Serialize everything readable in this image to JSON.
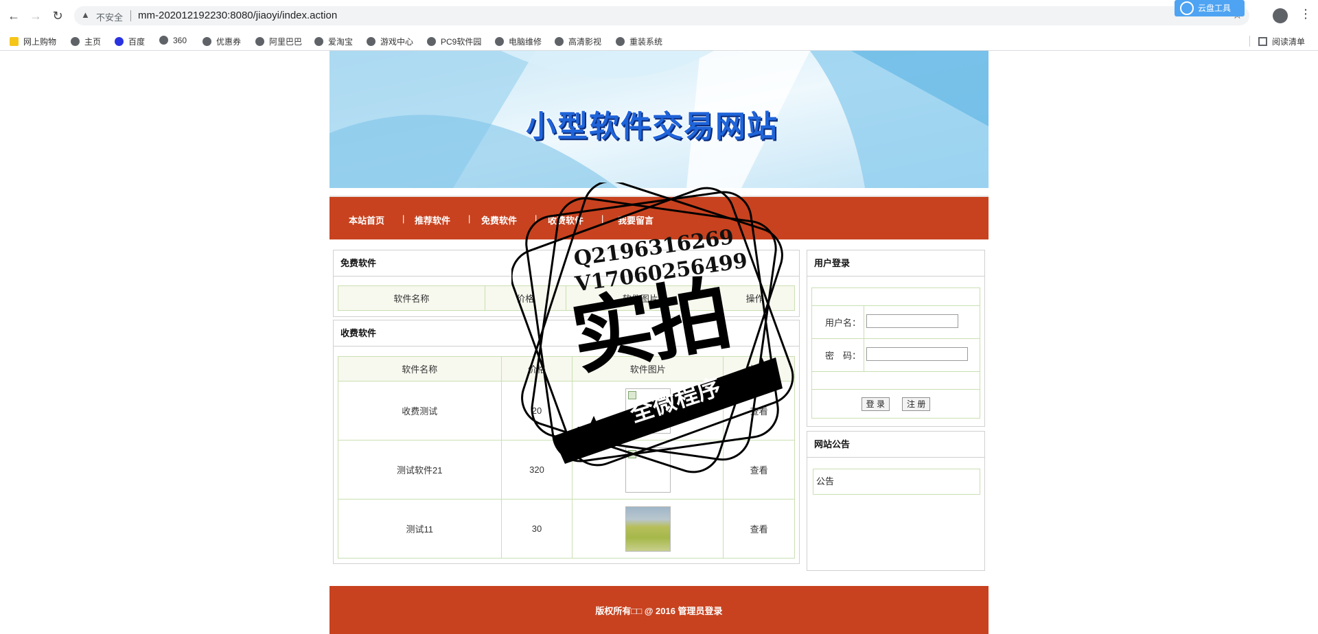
{
  "browser": {
    "insecure_label": "不安全",
    "url": "mm-202012192230:8080/jiaoyi/index.action",
    "extension_label": "云盘工具",
    "bookmarks": [
      "网上购物",
      "主页",
      "百度",
      "360",
      "优惠券",
      "阿里巴巴",
      "爱淘宝",
      "游戏中心",
      "PC9软件园",
      "电脑维修",
      "高清影视",
      "重装系统"
    ],
    "reading_list": "阅读清单"
  },
  "site": {
    "banner_title": "小型软件交易网站",
    "nav": [
      "本站首页",
      "推荐软件",
      "免费软件",
      "收费软件",
      "我要留言"
    ],
    "nav_separator": "|"
  },
  "free_software": {
    "title": "免费软件",
    "columns": [
      "软件名称",
      "价格",
      "软件图片",
      "操作"
    ]
  },
  "paid_software": {
    "title": "收费软件",
    "columns": [
      "软件名称",
      "价格",
      "软件图片",
      "操作"
    ],
    "rows": [
      {
        "name": "收费测试",
        "price": "20",
        "image": "broken",
        "action": "查看"
      },
      {
        "name": "测试软件21",
        "price": "320",
        "image": "broken",
        "action": "查看"
      },
      {
        "name": "测试11",
        "price": "30",
        "image": "photo",
        "action": "查看"
      }
    ]
  },
  "login": {
    "title": "用户登录",
    "username_label": "用户名：",
    "password_label": "密　码：",
    "login_button": "登 录",
    "register_button": "注 册"
  },
  "notice": {
    "title": "网站公告",
    "content": "公告"
  },
  "footer": {
    "text": "版权所有□□ @ 2016 管理员登录"
  },
  "watermark": {
    "qq": "Q2196316269",
    "wechat": "V17060256499",
    "main": "实拍",
    "ribbon": "全微程序"
  },
  "colors": {
    "nav_bg": "#c8421f",
    "table_border": "#c9dfb0",
    "table_head_bg": "#f7f8ee",
    "banner_title": "#1f64d9"
  }
}
